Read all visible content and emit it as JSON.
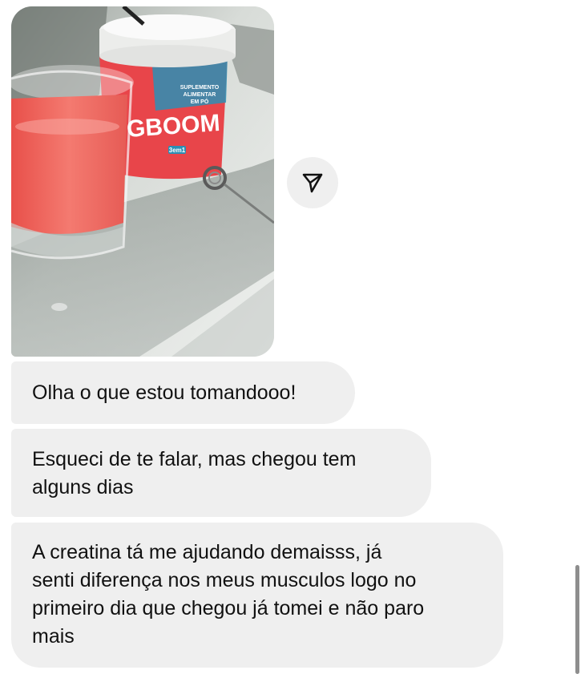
{
  "photo": {
    "alt_product": "supplement jar with pink drink",
    "jar_text": {
      "suplemento": "SUPLEMENTO\nALIMENTAR\nEM PÓ",
      "brand": "BIGBOOM",
      "sub": "3em1"
    }
  },
  "share_button": {
    "icon": "send-icon"
  },
  "messages": [
    {
      "text": "Olha o que estou tomandooo!"
    },
    {
      "text": "Esqueci de te falar, mas chegou tem\nalguns dias"
    },
    {
      "text": "A creatina tá me ajudando demaisss, já\nsenti diferença nos meus musculos logo no\nprimeiro dia que chegou já tomei e não paro\nmais"
    }
  ],
  "colors": {
    "bubble_bg": "#efefef",
    "text": "#111111",
    "jar_red": "#e8454a",
    "jar_teal": "#2b8fb5",
    "drink": "#f2706a"
  }
}
